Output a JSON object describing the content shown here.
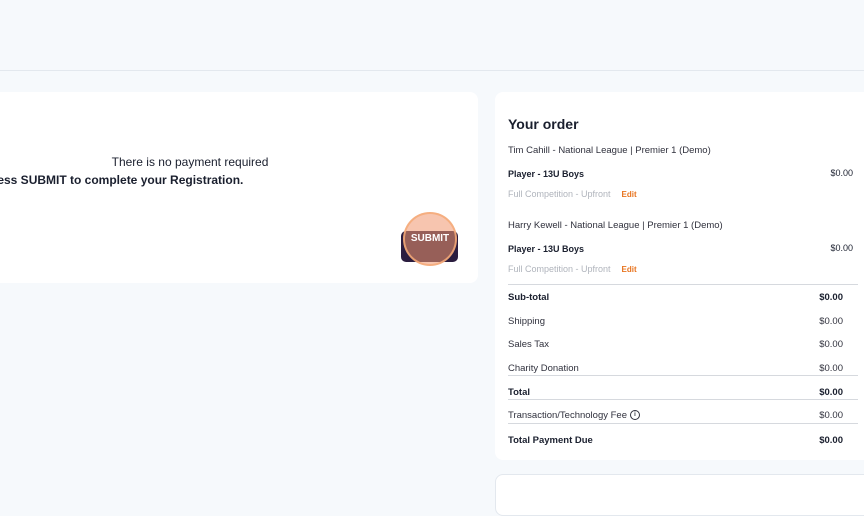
{
  "message": {
    "line1": "There is no payment required",
    "line2": "t press SUBMIT to complete your Registration."
  },
  "submit_label": "SUBMIT",
  "order": {
    "title": "Your order",
    "items": [
      {
        "name": "Tim Cahill - National League | Premier 1 (Demo)",
        "type": "Player - 13U Boys",
        "price": "$0.00",
        "plan": "Full Competition - Upfront",
        "edit": "Edit"
      },
      {
        "name": "Harry Kewell - National League | Premier 1 (Demo)",
        "type": "Player - 13U Boys",
        "price": "$0.00",
        "plan": "Full Competition - Upfront",
        "edit": "Edit"
      }
    ],
    "summary": {
      "subtotal": {
        "label": "Sub-total",
        "value": "$0.00"
      },
      "shipping": {
        "label": "Shipping",
        "value": "$0.00"
      },
      "sales_tax": {
        "label": "Sales Tax",
        "value": "$0.00"
      },
      "charity": {
        "label": "Charity Donation",
        "value": "$0.00"
      },
      "total": {
        "label": "Total",
        "value": "$0.00"
      },
      "fee": {
        "label": "Transaction/Technology Fee",
        "value": "$0.00",
        "icon": "info-icon"
      },
      "total_due": {
        "label": "Total Payment Due",
        "value": "$0.00"
      }
    }
  },
  "colors": {
    "accent": "#e8741f",
    "button": "#2b1d3f",
    "background": "#f6f9fc"
  }
}
